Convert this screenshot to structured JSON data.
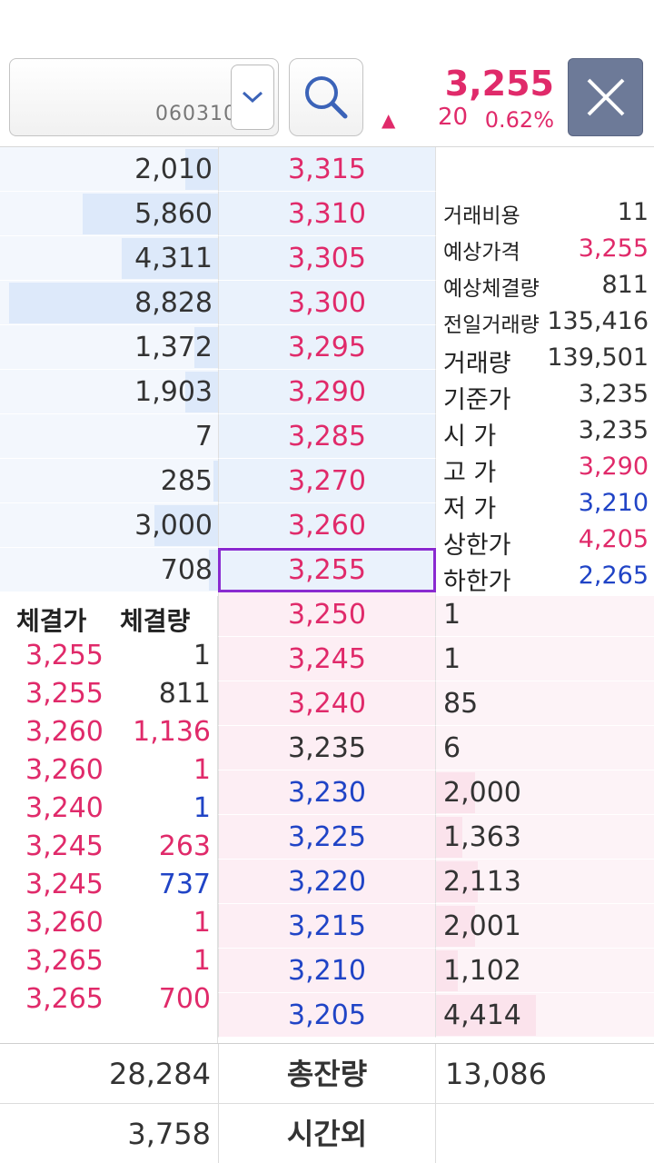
{
  "header": {
    "stock_code": "060310",
    "current_price": "3,255",
    "direction_symbol": "▲",
    "change": "20",
    "change_rate": "0.62%"
  },
  "order_book": {
    "asks": [
      {
        "qty": "2,010",
        "price": "3,315",
        "price_color": "red",
        "bar": 0.15
      },
      {
        "qty": "5,860",
        "price": "3,310",
        "price_color": "red",
        "bar": 0.62
      },
      {
        "qty": "4,311",
        "price": "3,305",
        "price_color": "red",
        "bar": 0.44
      },
      {
        "qty": "8,828",
        "price": "3,300",
        "price_color": "red",
        "bar": 0.96
      },
      {
        "qty": "1,372",
        "price": "3,295",
        "price_color": "red",
        "bar": 0.11
      },
      {
        "qty": "1,903",
        "price": "3,290",
        "price_color": "red",
        "bar": 0.15
      },
      {
        "qty": "7",
        "price": "3,285",
        "price_color": "red",
        "bar": 0.0
      },
      {
        "qty": "285",
        "price": "3,270",
        "price_color": "red",
        "bar": 0.02
      },
      {
        "qty": "3,000",
        "price": "3,260",
        "price_color": "red",
        "bar": 0.29
      },
      {
        "qty": "708",
        "price": "3,255",
        "price_color": "red",
        "bar": 0.04,
        "selected": true
      }
    ],
    "bids": [
      {
        "price": "3,250",
        "price_color": "red",
        "qty": "1",
        "bar": 0.0
      },
      {
        "price": "3,245",
        "price_color": "red",
        "qty": "1",
        "bar": 0.0
      },
      {
        "price": "3,240",
        "price_color": "red",
        "qty": "85",
        "bar": 0.0
      },
      {
        "price": "3,235",
        "price_color": "dark",
        "qty": "6",
        "bar": 0.0
      },
      {
        "price": "3,230",
        "price_color": "blue",
        "qty": "2,000",
        "bar": 0.18
      },
      {
        "price": "3,225",
        "price_color": "blue",
        "qty": "1,363",
        "bar": 0.12
      },
      {
        "price": "3,220",
        "price_color": "blue",
        "qty": "2,113",
        "bar": 0.19
      },
      {
        "price": "3,215",
        "price_color": "blue",
        "qty": "2,001",
        "bar": 0.18
      },
      {
        "price": "3,210",
        "price_color": "blue",
        "qty": "1,102",
        "bar": 0.1
      },
      {
        "price": "3,205",
        "price_color": "blue",
        "qty": "4,414",
        "bar": 0.46
      }
    ]
  },
  "info": [
    {
      "label": "거래비용",
      "value": "11",
      "color": "dark"
    },
    {
      "label": "예상가격",
      "value": "3,255",
      "color": "red"
    },
    {
      "label": "예상체결량",
      "value": "811",
      "color": "dark"
    },
    {
      "label": "전일거래량",
      "value": "135,416",
      "color": "dark"
    },
    {
      "label": "거래량",
      "value": "139,501",
      "color": "dark"
    },
    {
      "label": "기준가",
      "value": "3,235",
      "color": "dark"
    },
    {
      "label": "시  가",
      "value": "3,235",
      "color": "dark"
    },
    {
      "label": "고  가",
      "value": "3,290",
      "color": "red"
    },
    {
      "label": "저  가",
      "value": "3,210",
      "color": "blue"
    },
    {
      "label": "상한가",
      "value": "4,205",
      "color": "red",
      "label_color": "red"
    },
    {
      "label": "하한가",
      "value": "2,265",
      "color": "blue",
      "label_color": "blue"
    }
  ],
  "trades": {
    "price_header": "체결가",
    "volume_header": "체결량",
    "rows": [
      {
        "price": "3,255",
        "volume": "1",
        "vol_color": "dark"
      },
      {
        "price": "3,255",
        "volume": "811",
        "vol_color": "dark"
      },
      {
        "price": "3,260",
        "volume": "1,136",
        "vol_color": "red"
      },
      {
        "price": "3,260",
        "volume": "1",
        "vol_color": "red"
      },
      {
        "price": "3,240",
        "volume": "1",
        "vol_color": "blue"
      },
      {
        "price": "3,245",
        "volume": "263",
        "vol_color": "red"
      },
      {
        "price": "3,245",
        "volume": "737",
        "vol_color": "blue"
      },
      {
        "price": "3,260",
        "volume": "1",
        "vol_color": "red"
      },
      {
        "price": "3,265",
        "volume": "1",
        "vol_color": "red"
      },
      {
        "price": "3,265",
        "volume": "700",
        "vol_color": "red"
      }
    ]
  },
  "totals": {
    "ask_total": "28,284",
    "total_label": "총잔량",
    "bid_total": "13,086",
    "after_hours_ask": "3,758",
    "after_hours_label": "시간외",
    "after_hours_bid": ""
  },
  "colors": {
    "red": "#e02a6a",
    "blue": "#2044c6",
    "dark": "#333333",
    "selected_outline": "#8a2bd0"
  },
  "icons": {
    "dropdown": "chevron-down-icon",
    "search": "search-icon",
    "close": "close-icon"
  }
}
